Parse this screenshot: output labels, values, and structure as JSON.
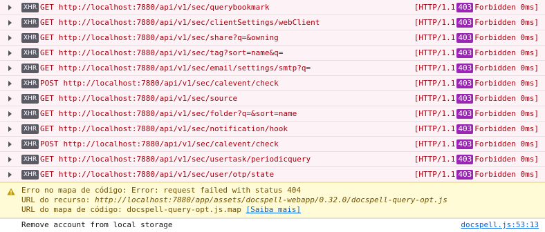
{
  "requests": [
    {
      "badge": "XHR",
      "method": "GET",
      "url": "http://localhost:7880/api/v1/sec/querybookmark",
      "proto": "[HTTP/1.1",
      "code": "403",
      "text": "Forbidden 0ms]"
    },
    {
      "badge": "XHR",
      "method": "GET",
      "url": "http://localhost:7880/api/v1/sec/clientSettings/webClient",
      "proto": "[HTTP/1.1",
      "code": "403",
      "text": "Forbidden 0ms]"
    },
    {
      "badge": "XHR",
      "method": "GET",
      "url": "http://localhost:7880/api/v1/sec/share?q=&owning",
      "proto": "[HTTP/1.1",
      "code": "403",
      "text": "Forbidden 0ms]"
    },
    {
      "badge": "XHR",
      "method": "GET",
      "url": "http://localhost:7880/api/v1/sec/tag?sort=name&q=",
      "proto": "[HTTP/1.1",
      "code": "403",
      "text": "Forbidden 0ms]"
    },
    {
      "badge": "XHR",
      "method": "GET",
      "url": "http://localhost:7880/api/v1/sec/email/settings/smtp?q=",
      "proto": "[HTTP/1.1",
      "code": "403",
      "text": "Forbidden 0ms]"
    },
    {
      "badge": "XHR",
      "method": "POST",
      "url": "http://localhost:7880/api/v1/sec/calevent/check",
      "proto": "[HTTP/1.1",
      "code": "403",
      "text": "Forbidden 0ms]"
    },
    {
      "badge": "XHR",
      "method": "GET",
      "url": "http://localhost:7880/api/v1/sec/source",
      "proto": "[HTTP/1.1",
      "code": "403",
      "text": "Forbidden 0ms]"
    },
    {
      "badge": "XHR",
      "method": "GET",
      "url": "http://localhost:7880/api/v1/sec/folder?q=&sort=name",
      "proto": "[HTTP/1.1",
      "code": "403",
      "text": "Forbidden 0ms]"
    },
    {
      "badge": "XHR",
      "method": "GET",
      "url": "http://localhost:7880/api/v1/sec/notification/hook",
      "proto": "[HTTP/1.1",
      "code": "403",
      "text": "Forbidden 0ms]"
    },
    {
      "badge": "XHR",
      "method": "POST",
      "url": "http://localhost:7880/api/v1/sec/calevent/check",
      "proto": "[HTTP/1.1",
      "code": "403",
      "text": "Forbidden 0ms]"
    },
    {
      "badge": "XHR",
      "method": "GET",
      "url": "http://localhost:7880/api/v1/sec/usertask/periodicquery",
      "proto": "[HTTP/1.1",
      "code": "403",
      "text": "Forbidden 0ms]"
    },
    {
      "badge": "XHR",
      "method": "GET",
      "url": "http://localhost:7880/api/v1/sec/user/otp/state",
      "proto": "[HTTP/1.1",
      "code": "403",
      "text": "Forbidden 0ms]"
    }
  ],
  "warning": {
    "line1": "Erro no mapa de código: Error: request failed with status 404",
    "line2_label": "URL do recurso: ",
    "line2_value": "http://localhost:7880/app/assets/docspell-webapp/0.32.0/docspell-query-opt.js",
    "line3_label": "URL do mapa de código: docspell-query-opt.js.map ",
    "line3_link": "[Saiba mais]"
  },
  "log": {
    "message": "Remove account from local storage",
    "source": "docspell.js:53:13"
  },
  "colors": {
    "error_text": "#a4000f",
    "status_badge": "#9b26b6",
    "warning_bg": "#fffbd6",
    "link": "#0060df"
  }
}
